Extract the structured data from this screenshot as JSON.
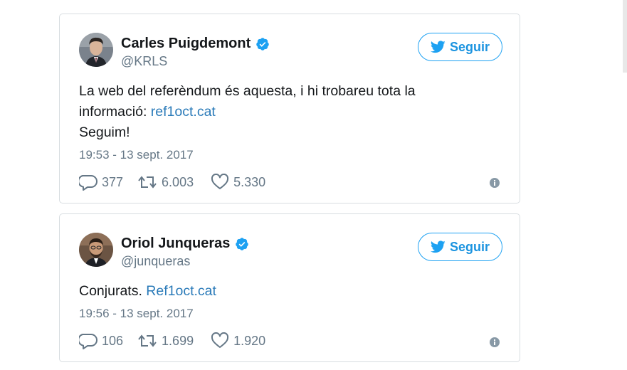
{
  "tweets": [
    {
      "name": "Carles Puigdemont",
      "handle": "@KRLS",
      "follow_label": "Seguir",
      "text_line1": "La web del referèndum és aquesta, i hi trobareu tota la",
      "text_line2_prefix": "informació: ",
      "text_line2_link": "ref1oct.cat",
      "text_line3": "Seguim!",
      "timestamp": "19:53 - 13 sept. 2017",
      "replies": "377",
      "retweets": "6.003",
      "likes": "5.330"
    },
    {
      "name": "Oriol Junqueras",
      "handle": "@junqueras",
      "follow_label": "Seguir",
      "text_prefix": "Conjurats. ",
      "text_link": "Ref1oct.cat",
      "timestamp": "19:56 - 13 sept. 2017",
      "replies": "106",
      "retweets": "1.699",
      "likes": "1.920"
    }
  ],
  "colors": {
    "accent": "#1da1f2",
    "link": "#2b7bb9",
    "muted": "#657786",
    "border": "#d8dde1"
  },
  "icons": {
    "verified": "verified-badge-icon",
    "follow": "twitter-bird-icon",
    "reply": "reply-icon",
    "retweet": "retweet-icon",
    "like": "heart-icon",
    "info": "info-icon"
  }
}
